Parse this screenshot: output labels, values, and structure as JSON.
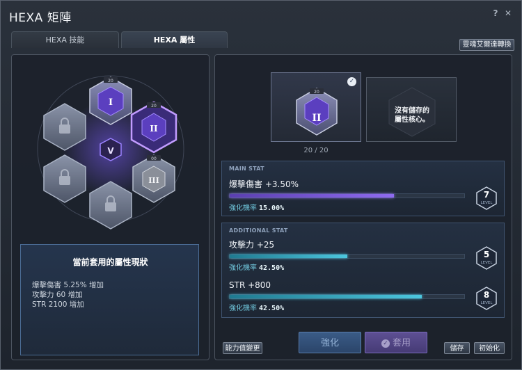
{
  "window": {
    "title": "HEXA 矩陣",
    "help_label": "?",
    "close_label": "✕"
  },
  "tabs": [
    {
      "label": "HEXA 技能",
      "active": false
    },
    {
      "label": "HEXA 屬性",
      "active": true
    }
  ],
  "top_right_button": "靈魂艾爾達轉換",
  "hex_grid": {
    "center_symbol": "V",
    "cores": [
      {
        "slot": "top",
        "level_label": "20",
        "glyph": "I",
        "state": "active-purple"
      },
      {
        "slot": "upper-right",
        "level_label": "20",
        "glyph": "II",
        "state": "selected"
      },
      {
        "slot": "lower-right",
        "level_label": "00",
        "glyph": "III",
        "state": "grey"
      },
      {
        "slot": "upper-left",
        "state": "locked"
      },
      {
        "slot": "lower-left",
        "state": "locked"
      },
      {
        "slot": "bottom",
        "state": "locked"
      }
    ]
  },
  "current_status": {
    "title": "當前套用的屬性現狀",
    "lines": [
      "爆擊傷害 5.25% 增加",
      "攻擊力 60 增加",
      "STR 2100 增加"
    ]
  },
  "core_cards": {
    "selected_level_label": "20",
    "selected_glyph": "II",
    "empty_text_line1": "沒有儲存的",
    "empty_text_line2": "屬性核心。",
    "count": "20 / 20"
  },
  "main_stat": {
    "header": "MAIN STAT",
    "name": "爆擊傷害 +3.50%",
    "progress": 0.7,
    "prob_label": "強化機率",
    "prob_value": "15.00%",
    "level": "7",
    "level_word": "LEVEL"
  },
  "additional_stat": {
    "header": "ADDITIONAL STAT",
    "items": [
      {
        "name": "攻擊力 +25",
        "progress": 0.5,
        "prob_label": "強化機率",
        "prob_value": "42.50%",
        "level": "5",
        "level_word": "LEVEL"
      },
      {
        "name": "STR +800",
        "progress": 0.82,
        "prob_label": "強化機率",
        "prob_value": "42.50%",
        "level": "8",
        "level_word": "LEVEL"
      }
    ]
  },
  "buttons": {
    "change_stats": "能力值變更",
    "enhance": "強化",
    "apply": "套用",
    "save": "儲存",
    "reset": "初始化"
  },
  "colors": {
    "accent_purple": "#8f6bf0",
    "accent_teal": "#4cc7de",
    "enhance_button": "#3a5b86",
    "apply_button": "#5d4f93"
  }
}
